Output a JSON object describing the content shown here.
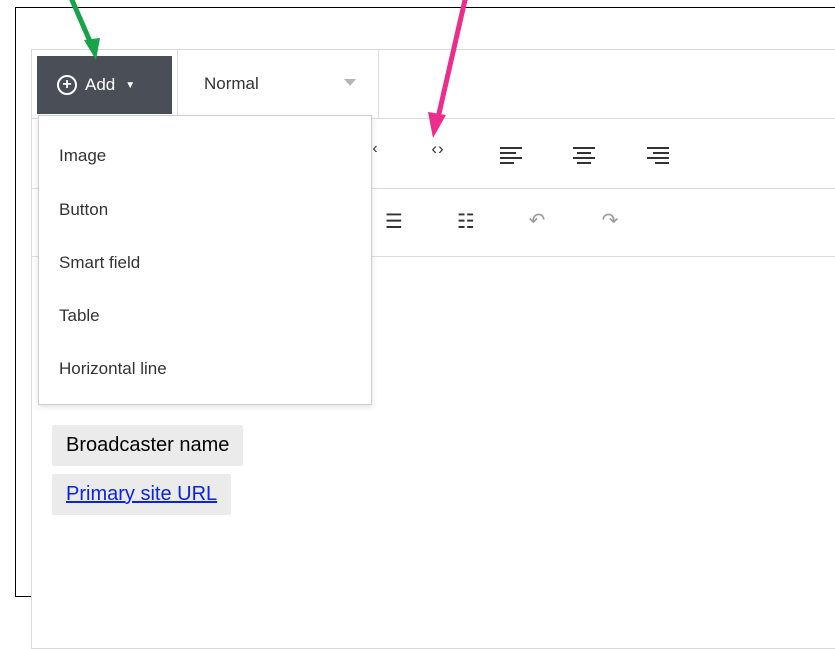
{
  "toolbar": {
    "add_label": "Add",
    "style_value": "Normal"
  },
  "dropdown": {
    "items": [
      {
        "label": "Image"
      },
      {
        "label": "Button"
      },
      {
        "label": "Smart field"
      },
      {
        "label": "Table"
      },
      {
        "label": "Horizontal line"
      }
    ]
  },
  "content": {
    "broadcaster_name": "Broadcaster name",
    "primary_site_url": "Primary site URL"
  },
  "colors": {
    "add_button_bg": "#4a4f57",
    "green_arrow": "#17a34a",
    "pink_arrow": "#ec2d8c",
    "link": "#0b22e6",
    "smart_field_bg": "#ebebeb"
  },
  "icons": [
    "plus-circle-icon",
    "caret-down-icon",
    "code-icon",
    "align-left-icon",
    "align-center-icon",
    "align-right-icon",
    "bullet-list-icon",
    "numbered-list-icon",
    "undo-icon",
    "redo-icon"
  ]
}
